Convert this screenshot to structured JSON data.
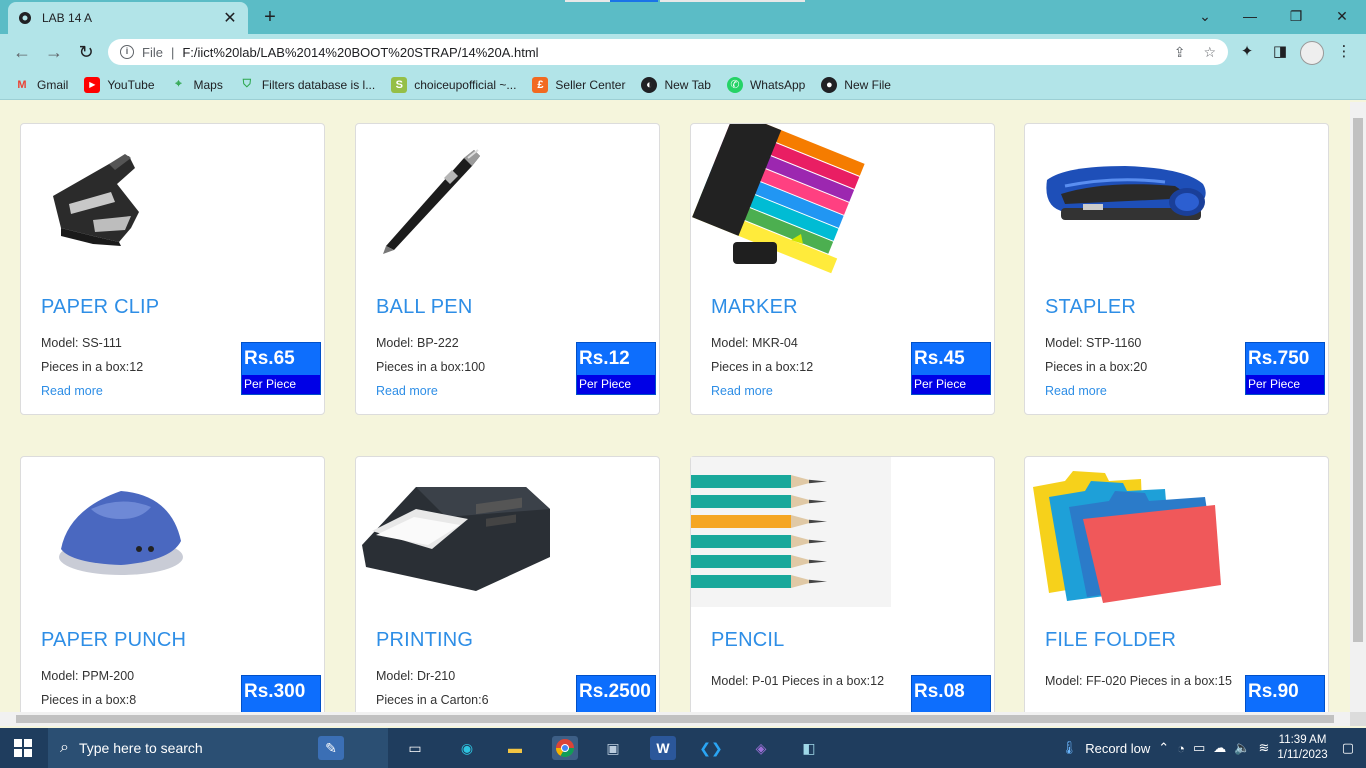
{
  "browser": {
    "tab_title": "LAB 14 A",
    "url_scheme": "File",
    "url": "F:/iict%20lab/LAB%2014%20BOOT%20STRAP/14%20A.html"
  },
  "bookmarks": [
    {
      "label": "Gmail",
      "icon": "gmail-icon",
      "color": "#ea4335"
    },
    {
      "label": "YouTube",
      "icon": "youtube-icon",
      "color": "#ff0000"
    },
    {
      "label": "Maps",
      "icon": "maps-icon",
      "color": "#34a853"
    },
    {
      "label": "Filters database is l...",
      "icon": "shield-icon",
      "color": "#2da84f"
    },
    {
      "label": "choiceupofficial ~...",
      "icon": "shopify-icon",
      "color": "#95bf47"
    },
    {
      "label": "Seller Center",
      "icon": "seller-icon",
      "color": "#f26a21"
    },
    {
      "label": "New Tab",
      "icon": "globe-icon",
      "color": "#202124"
    },
    {
      "label": "WhatsApp",
      "icon": "whatsapp-icon",
      "color": "#25d366"
    },
    {
      "label": "New File",
      "icon": "github-icon",
      "color": "#202124"
    }
  ],
  "products": [
    {
      "name": "PAPER CLIP",
      "model": "Model: SS-111",
      "pieces": "Pieces in a box:12",
      "read_more": "Read more",
      "price": "Rs.65",
      "per": "Per Piece",
      "image": "staple-remover"
    },
    {
      "name": "BALL PEN",
      "model": "Model: BP-222",
      "pieces": "Pieces in a box:100",
      "read_more": "Read more",
      "price": "Rs.12",
      "per": "Per Piece",
      "image": "pen"
    },
    {
      "name": "MARKER",
      "model": "Model: MKR-04",
      "pieces": "Pieces in a box:12",
      "read_more": "Read more",
      "price": "Rs.45",
      "per": "Per Piece",
      "image": "markers"
    },
    {
      "name": "STAPLER",
      "model": "Model: STP-1160",
      "pieces": "Pieces in a box:20",
      "read_more": "Read more",
      "price": "Rs.750",
      "per": "Per Piece",
      "image": "stapler"
    },
    {
      "name": "PAPER PUNCH",
      "model": "Model: PPM-200",
      "pieces": "Pieces in a box:8",
      "price": "Rs.300",
      "image": "punch"
    },
    {
      "name": "PRINTING",
      "model": "Model: Dr-210",
      "pieces": "Pieces in a Carton:6",
      "price": "Rs.2500",
      "image": "printer"
    },
    {
      "name": "PENCIL",
      "details": "Model: P-01 Pieces in a box:12",
      "price": "Rs.08",
      "image": "pencils"
    },
    {
      "name": "FILE FOLDER",
      "details": "Model: FF-020 Pieces in a box:15",
      "price": "Rs.90",
      "image": "folders"
    }
  ],
  "taskbar": {
    "search_placeholder": "Type here to search",
    "weather": "Record low",
    "time": "11:39 AM",
    "date": "1/11/2023"
  }
}
